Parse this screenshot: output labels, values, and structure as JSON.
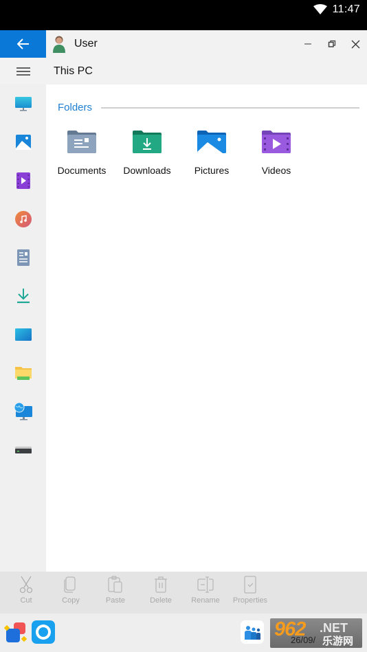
{
  "status_bar": {
    "time": "11:47",
    "wifi_icon": "wifi-icon"
  },
  "title_bar": {
    "back_icon": "arrow-left-icon",
    "user_icon": "user-avatar-icon",
    "user_name": "User",
    "minimize_icon": "minimize-icon",
    "restore_icon": "restore-icon",
    "close_icon": "close-icon",
    "accent_color": "#0a78d7"
  },
  "path_bar": {
    "menu_icon": "hamburger-icon",
    "title": "This PC"
  },
  "sidebar": {
    "items": [
      {
        "name": "this-pc",
        "icon": "monitor-icon"
      },
      {
        "name": "pictures",
        "icon": "picture-icon"
      },
      {
        "name": "videos",
        "icon": "video-icon"
      },
      {
        "name": "music",
        "icon": "music-icon"
      },
      {
        "name": "documents",
        "icon": "document-icon"
      },
      {
        "name": "downloads",
        "icon": "download-icon"
      },
      {
        "name": "desktop",
        "icon": "desktop-icon"
      },
      {
        "name": "file-explorer",
        "icon": "folder-icon"
      },
      {
        "name": "network",
        "icon": "network-icon"
      },
      {
        "name": "drive",
        "icon": "drive-icon"
      }
    ]
  },
  "content": {
    "section_title": "Folders",
    "section_color": "#1e7fd1",
    "folders": [
      {
        "label": "Documents",
        "icon": "documents-folder-icon"
      },
      {
        "label": "Downloads",
        "icon": "downloads-folder-icon"
      },
      {
        "label": "Pictures",
        "icon": "pictures-folder-icon"
      },
      {
        "label": "Videos",
        "icon": "videos-folder-icon"
      }
    ]
  },
  "toolbar": {
    "items": [
      {
        "label": "Cut",
        "icon": "scissors-icon"
      },
      {
        "label": "Copy",
        "icon": "copy-icon"
      },
      {
        "label": "Paste",
        "icon": "paste-icon"
      },
      {
        "label": "Delete",
        "icon": "trash-icon"
      },
      {
        "label": "Rename",
        "icon": "rename-icon"
      },
      {
        "label": "Properties",
        "icon": "properties-icon"
      }
    ]
  },
  "taskbar": {
    "apps": [
      {
        "name": "start-menu",
        "icon": "start-icon"
      },
      {
        "name": "cortana",
        "icon": "circle-app-icon"
      },
      {
        "name": "contacts",
        "icon": "people-icon"
      }
    ],
    "watermark": {
      "brand": "962",
      "suffix": ".NET",
      "cn": "乐游网",
      "date_partial": "26/09/"
    }
  }
}
